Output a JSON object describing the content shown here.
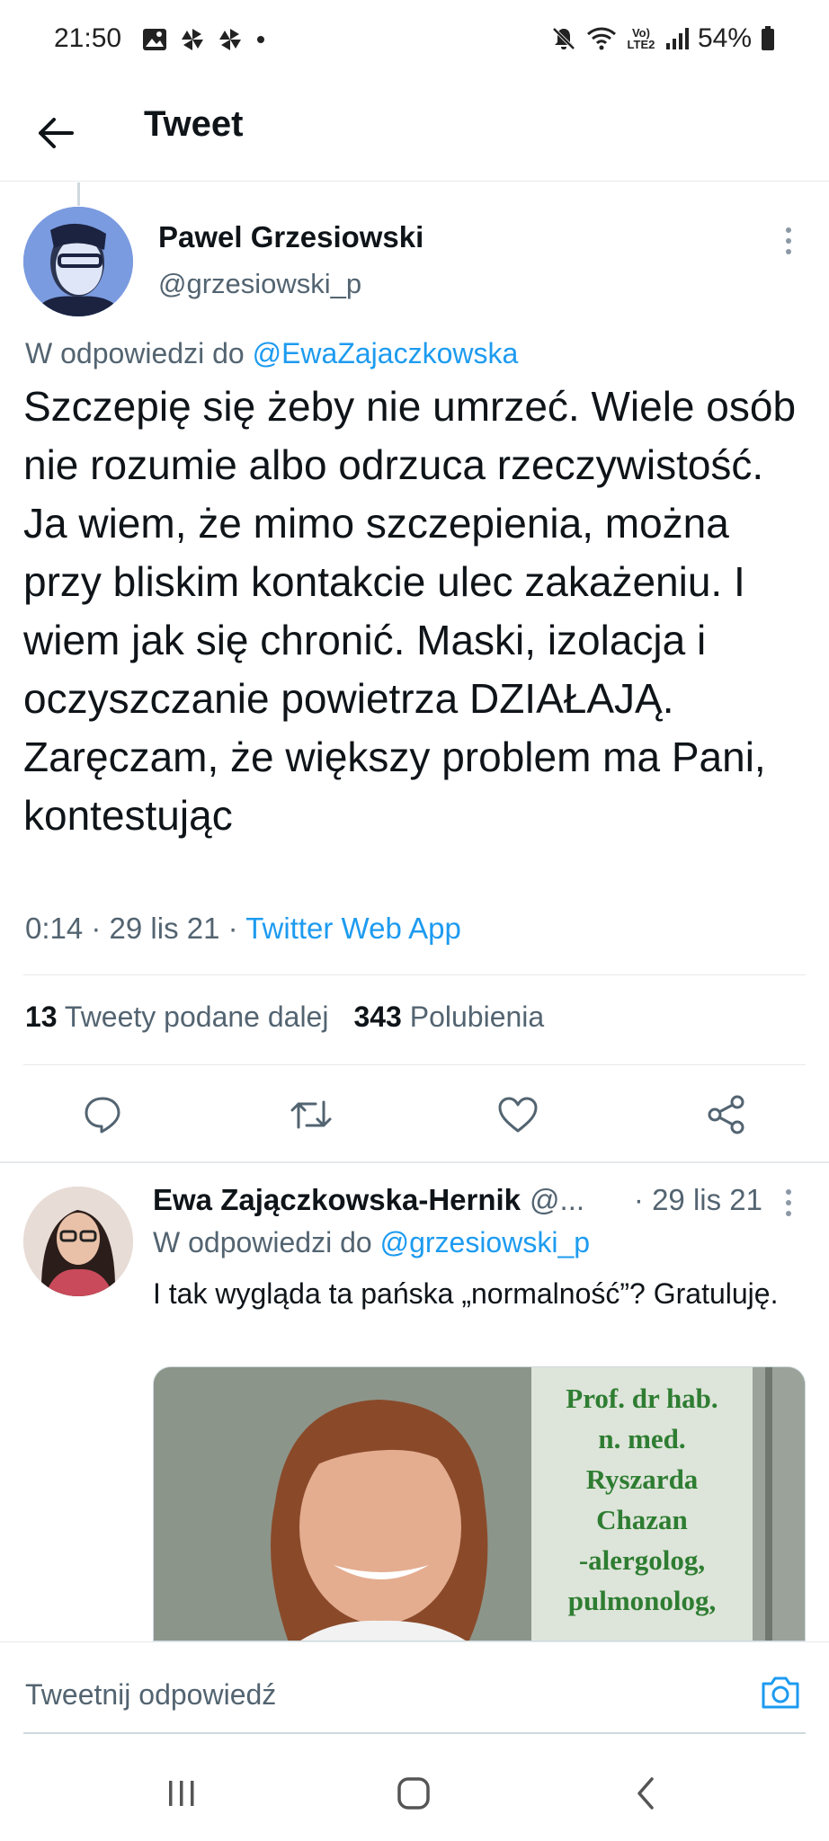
{
  "status_bar": {
    "time": "21:50",
    "network_label": "Vo) LTE2",
    "battery_text": "54%",
    "left_icons": [
      "gallery-icon",
      "pinwheel-icon",
      "pinwheel-icon",
      "dot-icon"
    ],
    "right_icons": [
      "mute-icon",
      "wifi-icon",
      "signal-icon",
      "battery-icon"
    ]
  },
  "header": {
    "title": "Tweet",
    "back_icon": "arrow-left-icon"
  },
  "main_tweet": {
    "author_name": "Pawel Grzesiowski",
    "author_handle": "@grzesiowski_p",
    "replying_prefix": "W odpowiedzi do",
    "replying_to": "@EwaZajaczkowska",
    "text": "Szczepię się żeby nie umrzeć. Wiele osób nie rozumie albo odrzuca rzeczywistość. Ja wiem, że mimo szczepienia, można przy bliskim kontakcie ulec zakażeniu. I wiem jak się chronić. Maski, izolacja i oczyszczanie powietrza DZIAŁAJĄ. Zaręczam, że większy problem ma Pani, kontestując",
    "time_date": "0:14 · 29 lis 21 · ",
    "source": "Twitter Web App",
    "retweets_count": "13",
    "retweets_label": "Tweety podane dalej",
    "likes_count": "343",
    "likes_label": "Polubienia",
    "actions": [
      "reply-icon",
      "retweet-icon",
      "like-icon",
      "share-icon"
    ]
  },
  "reply_tweet": {
    "author_name": "Ewa Zajączkowska-Hernik",
    "author_handle": "@...",
    "date": "· 29 lis 21",
    "replying_prefix": "W odpowiedzi do",
    "replying_to": "@grzesiowski_p",
    "text": "I tak wygląda ta pańska „normalność”? Gratuluję.",
    "image_text": [
      "Prof. dr hab.",
      "n. med.",
      "Ryszarda",
      "Chazan",
      "-alergolog,",
      "pulmonolog,"
    ]
  },
  "compose": {
    "placeholder": "Tweetnij odpowiedź",
    "camera_icon": "camera-icon"
  },
  "navbar": {
    "buttons": [
      "recent-apps-icon",
      "home-icon",
      "back-icon"
    ]
  },
  "colors": {
    "accent": "#1d9bf0",
    "text_primary": "#0f1419",
    "text_secondary": "#536471",
    "divider": "#e6e9eb",
    "image_text_green": "#2e7d32"
  }
}
